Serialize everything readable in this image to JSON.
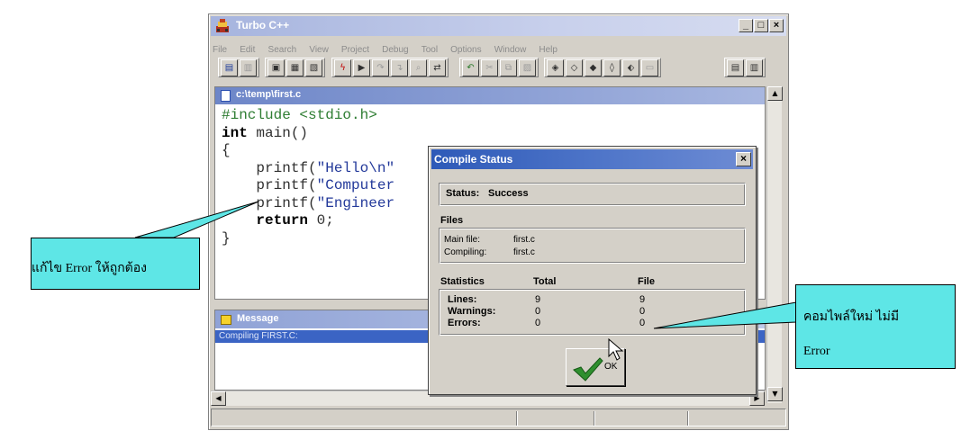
{
  "window": {
    "title": "Turbo C++",
    "minimize_label": "_",
    "maximize_label": "□",
    "close_label": "×",
    "menu": [
      "File",
      "Edit",
      "Search",
      "View",
      "Project",
      "Debug",
      "Tool",
      "Options",
      "Window",
      "Help"
    ]
  },
  "toolbar": {
    "icons": [
      "open-icon",
      "save-icon",
      "make-icon",
      "build-icon",
      "build-all-icon",
      "compile-icon",
      "run-icon",
      "step-over-icon",
      "trace-into-icon",
      "find-icon",
      "replace-icon",
      "undo-icon",
      "cut-icon",
      "copy-icon",
      "paste-icon",
      "bookmark-icon",
      "goto-icon",
      "search-again-icon",
      "browse-icon",
      "inspect-icon",
      "help-icon",
      "tile-icon",
      "cascade-icon"
    ]
  },
  "editor": {
    "title": "c:\\temp\\first.c",
    "code": [
      [
        {
          "t": "pp",
          "v": "#include <stdio.h>"
        }
      ],
      [
        {
          "t": "kw",
          "v": "int"
        },
        {
          "t": "plain",
          "v": " main()"
        }
      ],
      [
        {
          "t": "plain",
          "v": "{"
        }
      ],
      [
        {
          "t": "plain",
          "v": "    printf("
        },
        {
          "t": "str",
          "v": "\"Hello\\n\""
        }
      ],
      [
        {
          "t": "plain",
          "v": "    printf("
        },
        {
          "t": "str",
          "v": "\"Computer"
        }
      ],
      [
        {
          "t": "plain",
          "v": "    printf("
        },
        {
          "t": "str",
          "v": "\"Engineer"
        }
      ],
      [
        {
          "t": "plain",
          "v": "    "
        },
        {
          "t": "kw",
          "v": "return"
        },
        {
          "t": "plain",
          "v": " 0;"
        }
      ],
      [
        {
          "t": "plain",
          "v": "}"
        }
      ]
    ]
  },
  "message": {
    "title": "Message",
    "line": "Compiling FIRST.C:"
  },
  "dialog": {
    "title": "Compile Status",
    "close_label": "×",
    "status_label": "Status:",
    "status_value": "Success",
    "files_heading": "Files",
    "main_file_label": "Main file:",
    "main_file_value": "first.c",
    "compiling_label": "Compiling:",
    "compiling_value": "first.c",
    "stats_heading": "Statistics",
    "total_heading": "Total",
    "file_heading": "File",
    "rows": [
      {
        "label": "Lines:",
        "total": "9",
        "file": "9"
      },
      {
        "label": "Warnings:",
        "total": "0",
        "file": "0"
      },
      {
        "label": "Errors:",
        "total": "0",
        "file": "0"
      }
    ],
    "ok_label": "OK"
  },
  "callouts": {
    "left_text": "แก้ไข Error ให้ถูกต้อง",
    "right_line1": "คอมไพล์ใหม่ ไม่มี",
    "right_line2": "Error",
    "color": "#5ee6e6"
  }
}
